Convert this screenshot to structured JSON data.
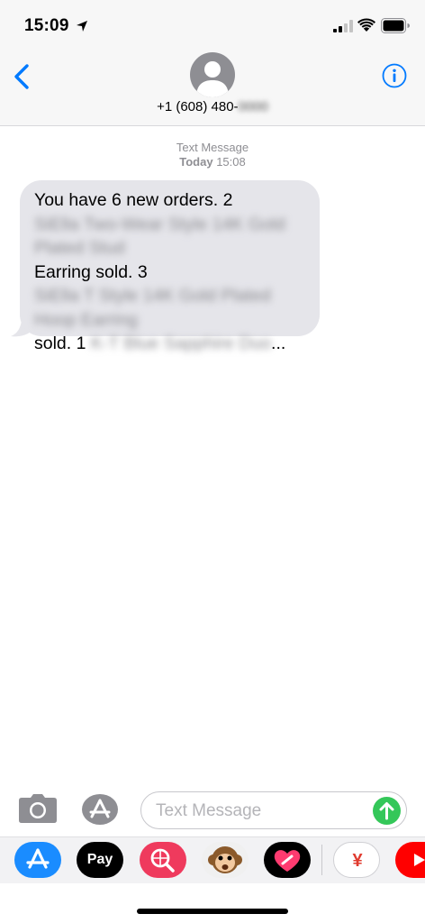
{
  "status_bar": {
    "time": "15:09"
  },
  "header": {
    "contact_visible": "+1 (608) 480-",
    "contact_redacted": "0000"
  },
  "thread": {
    "service_label": "Text Message",
    "day_label": "Today",
    "time_label": "15:08",
    "message": {
      "segments": [
        {
          "text": "You have 6 new orders. 2 ",
          "redacted": false
        },
        {
          "text": "SiElla Two-Wear Style 14K Gold Plated Stud",
          "redacted": true
        },
        {
          "text": " Earring sold. 3 ",
          "redacted": false
        },
        {
          "text": "SiElla T Style 14K Gold Plated Hoop Earring",
          "redacted": true
        },
        {
          "text": " sold. 1 ",
          "redacted": false
        },
        {
          "text": "K-T Blue Sapphire Duo",
          "redacted": true
        },
        {
          "text": "...",
          "redacted": false
        }
      ]
    }
  },
  "compose": {
    "placeholder": "Text Message"
  },
  "app_drawer": {
    "apps": [
      {
        "name": "app-store-icon",
        "color": "#1a8cff"
      },
      {
        "name": "apple-pay-icon",
        "label": "Pay",
        "color": "#000000"
      },
      {
        "name": "image-search-icon",
        "color": "#ef3a5d"
      },
      {
        "name": "animoji-monkey-icon",
        "color": "#f0f0f0"
      },
      {
        "name": "digital-touch-icon",
        "color": "#000000"
      },
      {
        "name": "yen-app-icon",
        "label": "¥",
        "color": "#ffffff"
      },
      {
        "name": "youtube-icon",
        "color": "#ff0000"
      }
    ]
  },
  "colors": {
    "accent": "#007aff",
    "bubble": "#e5e5ea",
    "send": "#34c759",
    "avatar": "#8e8e93"
  }
}
